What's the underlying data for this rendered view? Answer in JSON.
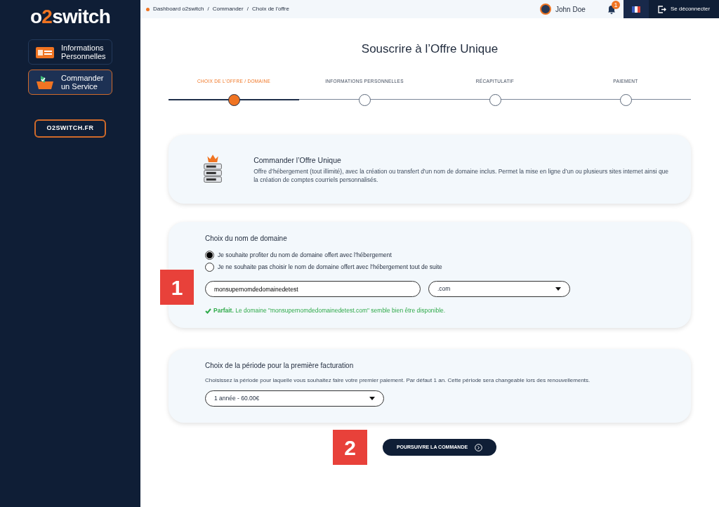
{
  "sidebar": {
    "logo": {
      "prefix": "o",
      "accent": "2",
      "suffix": "switch"
    },
    "items": [
      {
        "label": "Informations Personnelles",
        "selected": false
      },
      {
        "label": "Commander un Service",
        "selected": true
      }
    ],
    "site_link": "O2SWITCH.FR"
  },
  "topbar": {
    "breadcrumb": [
      "Dashboard o2switch",
      "Commander",
      "Choix de l'offre"
    ],
    "separator": "/",
    "user": "John Doe",
    "notifications": "1",
    "logout": "Se déconnecter"
  },
  "title": "Souscrire à l’Offre Unique",
  "steps": [
    {
      "label": "CHOIX DE L’OFFRE / DOMAINE",
      "selected": true
    },
    {
      "label": "INFORMATIONS PERSONNELLES",
      "selected": false
    },
    {
      "label": "RÉCAPITULATIF",
      "selected": false
    },
    {
      "label": "PAIEMENT",
      "selected": false
    }
  ],
  "offer": {
    "title": "Commander l’Offre Unique",
    "description": "Offre d’hébergement (tout illimité), avec la création ou transfert d’un nom de domaine inclus. Permet la mise en ligne d’un ou plusieurs sites internet ainsi que la création de comptes courriels personnalisés."
  },
  "domain": {
    "title": "Choix du nom de domaine",
    "options": [
      {
        "label": "Je souhaite profiter du nom de domaine offert avec l’hébergement",
        "selected": true
      },
      {
        "label": "Je ne souhaite pas choisir le nom de domaine offert avec l’hébergement tout de suite",
        "selected": false
      }
    ],
    "name_value": "monsupernomdedomainedetest",
    "extension": ".com",
    "message": "**Parfait.** Le domaine \"monsupernomdedomainedetest.com\" semble bien être disponible."
  },
  "billing": {
    "title": "Choix de la période pour la première facturation",
    "description": "Choisissez la période pour laquelle vous souhaitez faire votre premier paiement. Par défaut 1 an. Cette période sera changeable lors des renouvellements.",
    "period": "1 année - 60.00€"
  },
  "continue_button": "POURSUIVRE LA COMMANDE",
  "annotations": [
    "1",
    "2"
  ]
}
